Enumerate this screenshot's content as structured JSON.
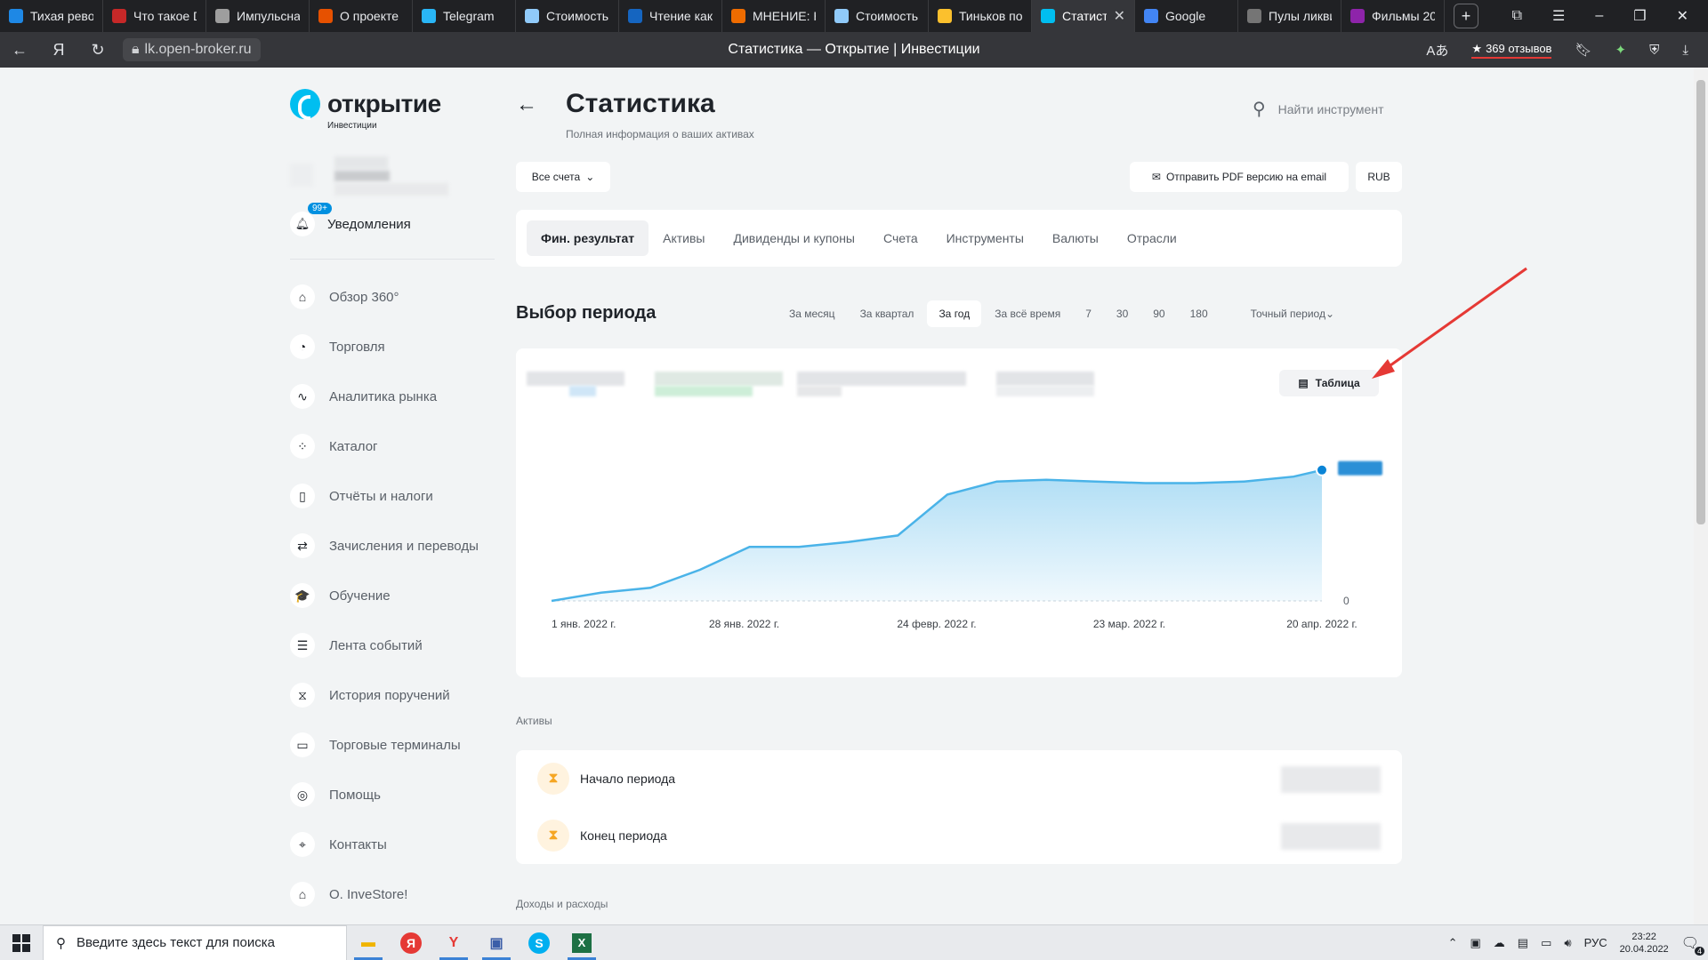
{
  "browser": {
    "tabs": [
      {
        "title": "Тихая рево",
        "color": "#1e88e5"
      },
      {
        "title": "Что такое D",
        "color": "#c62828"
      },
      {
        "title": "Импульсна",
        "color": "#9e9e9e"
      },
      {
        "title": "О проекте",
        "color": "#e65100"
      },
      {
        "title": "Telegram",
        "color": "#29b6f6"
      },
      {
        "title": "Стоимость",
        "color": "#90caf9"
      },
      {
        "title": "Чтение как",
        "color": "#1565c0"
      },
      {
        "title": "МНЕНИЕ: Н",
        "color": "#ef6c00"
      },
      {
        "title": "Стоимость",
        "color": "#90caf9"
      },
      {
        "title": "Тиньков по",
        "color": "#fbc02d"
      },
      {
        "title": "Статистик",
        "color": "#00bef0",
        "active": true
      },
      {
        "title": "Google",
        "color": "#4285f4"
      },
      {
        "title": "Пулы ликви",
        "color": "#757575"
      },
      {
        "title": "Фильмы 20",
        "color": "#8e24aa"
      }
    ],
    "url": "lk.open-broker.ru",
    "page_title": "Статистика — Открытие | Инвестиции",
    "reviews": "369 отзывов"
  },
  "sidebar": {
    "brand": "открытие",
    "brand_sub": "Инвестиции",
    "notifications_badge": "99+",
    "notifications_label": "Уведомления",
    "items": [
      {
        "label": "Обзор 360°",
        "icon": "home-icon",
        "glyph": "⌂"
      },
      {
        "label": "Торговля",
        "icon": "trading-icon",
        "glyph": "◔"
      },
      {
        "label": "Аналитика рынка",
        "icon": "pulse-icon",
        "glyph": "∿"
      },
      {
        "label": "Каталог",
        "icon": "catalog-icon",
        "glyph": "⁘"
      },
      {
        "label": "Отчёты и налоги",
        "icon": "document-icon",
        "glyph": "▯"
      },
      {
        "label": "Зачисления и переводы",
        "icon": "transfer-icon",
        "glyph": "⇄"
      },
      {
        "label": "Обучение",
        "icon": "graduation-cap-icon",
        "glyph": "🎓"
      },
      {
        "label": "Лента событий",
        "icon": "feed-icon",
        "glyph": "☰"
      },
      {
        "label": "История поручений",
        "icon": "hourglass-icon",
        "glyph": "⧖"
      },
      {
        "label": "Торговые терминалы",
        "icon": "terminal-icon",
        "glyph": "▭"
      },
      {
        "label": "Помощь",
        "icon": "lifebuoy-icon",
        "glyph": "◎"
      },
      {
        "label": "Контакты",
        "icon": "location-icon",
        "glyph": "⌖"
      },
      {
        "label": "О. InveStore!",
        "icon": "store-icon",
        "glyph": "⌂"
      }
    ]
  },
  "header": {
    "title": "Статистика",
    "subtitle": "Полная информация о ваших активах",
    "search_placeholder": "Найти инструмент"
  },
  "toolbar": {
    "accounts": "Все счета",
    "send_pdf": "Отправить PDF версию на email",
    "currency": "RUB"
  },
  "tabs": [
    {
      "label": "Фин. результат",
      "active": true
    },
    {
      "label": "Активы"
    },
    {
      "label": "Дивиденды и купоны"
    },
    {
      "label": "Счета"
    },
    {
      "label": "Инструменты"
    },
    {
      "label": "Валюты"
    },
    {
      "label": "Отрасли"
    }
  ],
  "period": {
    "title": "Выбор периода",
    "options": [
      {
        "label": "За месяц"
      },
      {
        "label": "За квартал"
      },
      {
        "label": "За год",
        "active": true
      },
      {
        "label": "За всё время"
      },
      {
        "label": "7"
      },
      {
        "label": "30"
      },
      {
        "label": "90"
      },
      {
        "label": "180"
      }
    ],
    "exact": "Точный период"
  },
  "chart": {
    "table_button": "Таблица"
  },
  "chart_data": {
    "type": "area",
    "title": "",
    "xlabel": "",
    "ylabel": "",
    "x_tick_labels": [
      "1 янв. 2022 г.",
      "28 янв. 2022 г.",
      "24 февр. 2022 г.",
      "23 мар. 2022 г.",
      "20 апр. 2022 г."
    ],
    "y_tick_labels": [
      "0"
    ],
    "x": [
      "2022-01-01",
      "2022-01-08",
      "2022-01-15",
      "2022-01-22",
      "2022-01-29",
      "2022-02-05",
      "2022-02-12",
      "2022-02-19",
      "2022-02-26",
      "2022-03-05",
      "2022-03-12",
      "2022-03-19",
      "2022-03-26",
      "2022-04-02",
      "2022-04-09",
      "2022-04-16",
      "2022-04-20"
    ],
    "y": [
      0,
      5,
      8,
      19,
      33,
      33,
      36,
      40,
      65,
      73,
      74,
      73,
      72,
      72,
      73,
      76,
      80
    ],
    "y_note": "values blurred in original; relative scale 0-100",
    "ylim": [
      0,
      100
    ],
    "color": "#4ab3e8",
    "grid": false
  },
  "assets": {
    "section_label": "Активы",
    "rows": [
      {
        "label": "Начало периода",
        "icon": "hourglass-icon"
      },
      {
        "label": "Конец периода",
        "icon": "hourglass-icon"
      }
    ]
  },
  "income_section_label": "Доходы и расходы",
  "taskbar": {
    "search_placeholder": "Введите здесь текст для поиска",
    "lang": "РУС",
    "time": "23:22",
    "date": "20.04.2022",
    "notif_count": "4"
  },
  "colors": {
    "accent": "#00bef0",
    "chart_line": "#4ab3e8",
    "annotation_arrow": "#e53935"
  }
}
